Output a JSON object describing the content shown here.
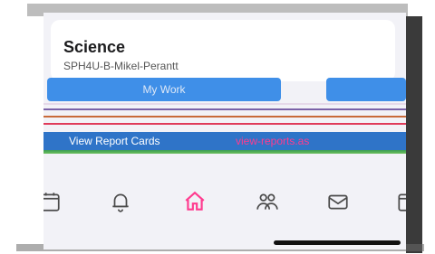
{
  "course": {
    "title": "Science",
    "subtitle": "SPH4U-B-Mikel-Perantt"
  },
  "actions": {
    "my_work_label": "My Work",
    "right_button_label": ""
  },
  "report": {
    "link_label": "View Report Cards",
    "url_text": "view-reports.as"
  },
  "tabs": [
    {
      "name": "calendar",
      "label": "",
      "icon": "calendar-icon",
      "active": false
    },
    {
      "name": "alerts",
      "label": "",
      "icon": "bell-icon",
      "active": false
    },
    {
      "name": "home",
      "label": "",
      "icon": "home-icon",
      "active": true
    },
    {
      "name": "people",
      "label": "",
      "icon": "people-icon",
      "active": false
    },
    {
      "name": "messages",
      "label": "",
      "icon": "mail-icon",
      "active": false
    },
    {
      "name": "more",
      "label": "",
      "icon": "more-icon",
      "active": false
    }
  ],
  "colors": {
    "accent": "#ff3b8f",
    "button_blue": "#3f8fe8",
    "report_blue": "#2f74c8",
    "inactive_icon": "#4a4a4a"
  }
}
